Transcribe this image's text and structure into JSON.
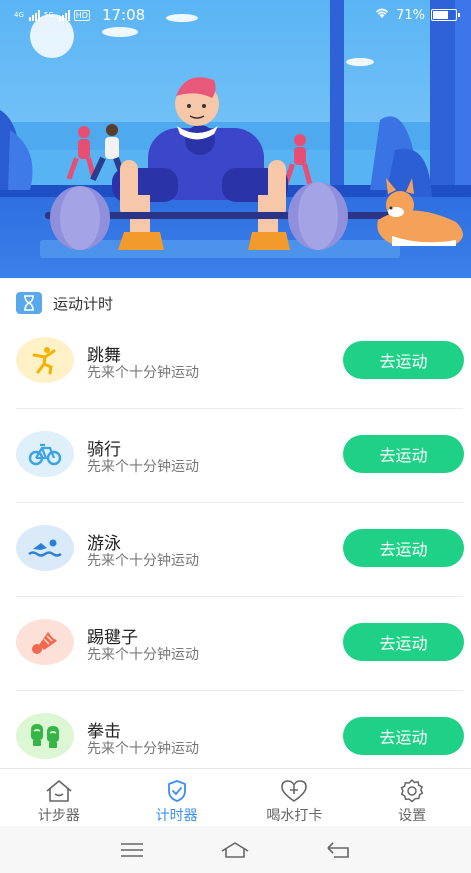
{
  "status": {
    "network_1": "4G",
    "network_2": "5G",
    "hd": "HD",
    "time": "17:08",
    "battery_text": "71%",
    "battery_level": 0.71
  },
  "hero": {
    "icon": "fitness-banner-illustration"
  },
  "section": {
    "icon": "hourglass-icon",
    "title": "运动计时"
  },
  "activities": [
    {
      "name": "跳舞",
      "subtitle": "先来个十分钟运动",
      "button": "去运动",
      "icon": "dance-icon",
      "icon_bg": "#fff1c7",
      "icon_color": "#f2b200"
    },
    {
      "name": "骑行",
      "subtitle": "先来个十分钟运动",
      "button": "去运动",
      "icon": "bicycle-icon",
      "icon_bg": "#dff0fb",
      "icon_color": "#3aa3e3"
    },
    {
      "name": "游泳",
      "subtitle": "先来个十分钟运动",
      "button": "去运动",
      "icon": "swimming-icon",
      "icon_bg": "#dbeaf8",
      "icon_color": "#2c7fd6"
    },
    {
      "name": "踢毽子",
      "subtitle": "先来个十分钟运动",
      "button": "去运动",
      "icon": "shuttlecock-icon",
      "icon_bg": "#fde0d8",
      "icon_color": "#f0684e"
    },
    {
      "name": "拳击",
      "subtitle": "先来个十分钟运动",
      "button": "去运动",
      "icon": "boxing-gloves-icon",
      "icon_bg": "#ddf6d4",
      "icon_color": "#35b646"
    }
  ],
  "tabs": [
    {
      "label": "计步器",
      "icon": "home-icon",
      "active": false
    },
    {
      "label": "计时器",
      "icon": "timer-check-icon",
      "active": true
    },
    {
      "label": "喝水打卡",
      "icon": "heart-plus-icon",
      "active": false
    },
    {
      "label": "设置",
      "icon": "gear-icon",
      "active": false
    }
  ],
  "colors": {
    "accent": "#1ed187",
    "tab_active": "#3b8ff0",
    "tab_inactive": "#666666"
  }
}
